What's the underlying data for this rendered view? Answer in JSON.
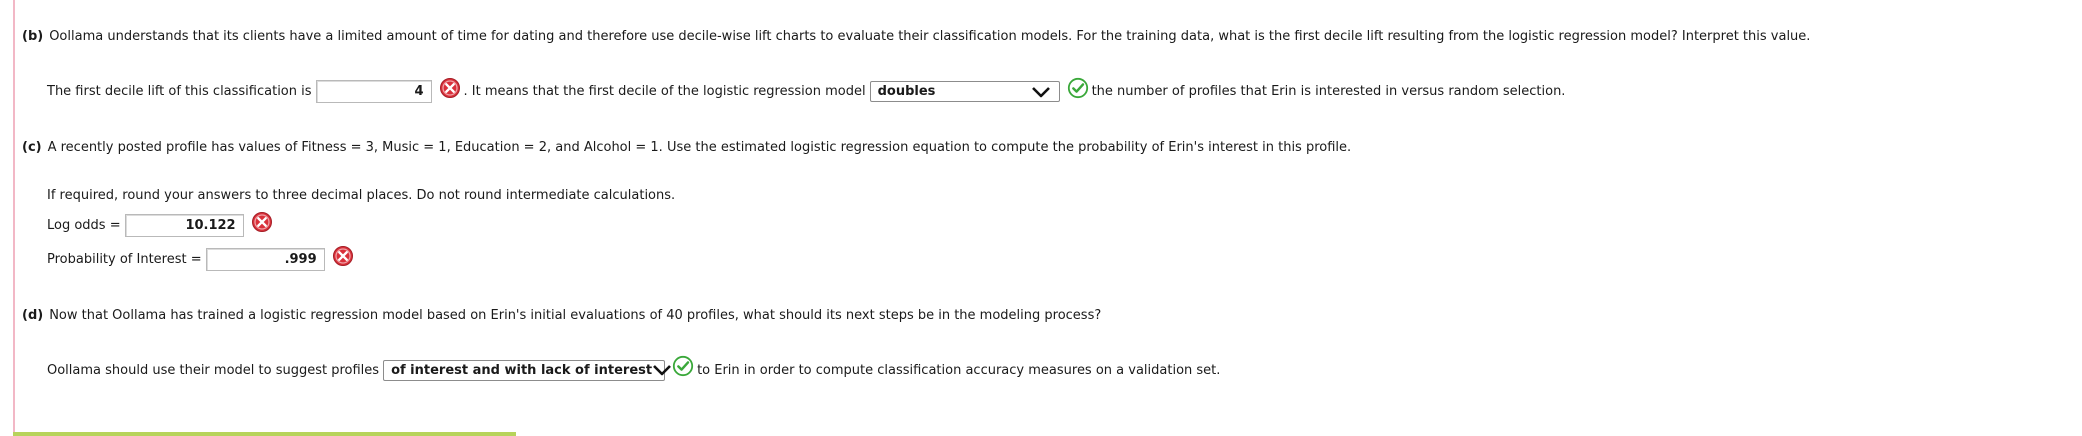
{
  "part_b": {
    "label": "(b)",
    "question": "Oollama understands that its clients have a limited amount of time for dating and therefore use decile-wise lift charts to evaluate their classification models. For the training data, what is the first decile lift resulting from the logistic regression model? Interpret this value.",
    "text_before": "The first decile lift of this classification is",
    "lift_value": "4",
    "text_middle": ". It means that the first decile of the logistic regression model",
    "select_value": "doubles",
    "text_after": "the number of profiles that Erin is interested in versus random selection."
  },
  "part_c": {
    "label": "(c)",
    "question": "A recently posted profile has values of Fitness = 3, Music = 1, Education = 2, and Alcohol = 1. Use the estimated logistic regression equation to compute the probability of Erin's interest in this profile.",
    "instruction": "If required, round your answers to three decimal places. Do not round intermediate calculations.",
    "log_odds_label": "Log odds =",
    "log_odds_value": "10.122",
    "prob_label": "Probability of Interest =",
    "prob_value": ".999"
  },
  "part_d": {
    "label": "(d)",
    "question": "Now that Oollama has trained a logistic regression model based on Erin's initial evaluations of 40 profiles, what should its next steps be in the modeling process?",
    "text_before": "Oollama should use their model to suggest profiles",
    "select_value": "of interest and with lack of interest",
    "text_after": "to Erin in order to compute classification accuracy measures on a validation set."
  },
  "colors": {
    "incorrect": "#d9303a",
    "correct": "#3aa83a",
    "accent_bar": "#b7d35b",
    "left_rule": "#f2b8c6"
  },
  "icons": {
    "incorrect": "x-circle-icon",
    "correct": "check-circle-icon",
    "dropdown": "chevron-down-icon"
  }
}
